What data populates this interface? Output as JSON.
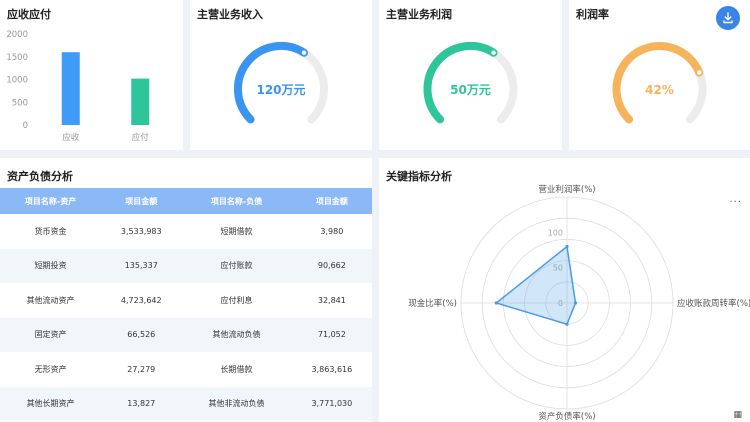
{
  "ar_card": {
    "title": "应收应付",
    "chart_data": {
      "type": "bar",
      "categories": [
        "应收",
        "应付"
      ],
      "values": [
        1600,
        1020
      ],
      "ylim": [
        0,
        2000
      ],
      "yticks": [
        0,
        500,
        1000,
        1500,
        2000
      ],
      "colors": [
        "#3e9bf6",
        "#2fc59b"
      ],
      "grid": false
    }
  },
  "revenue_card": {
    "title": "主营业务收入",
    "value_label": "120万元",
    "fraction": 0.62,
    "color": "#3a95f0"
  },
  "profit_card": {
    "title": "主营业务利润",
    "value_label": "50万元",
    "fraction": 0.62,
    "color": "#2fc59b"
  },
  "rate_card": {
    "title": "利润率",
    "value_label": "42%",
    "fraction": 0.75,
    "color": "#f5b45c"
  },
  "balance_card": {
    "title": "资产负债分析",
    "headers": [
      "项目名称-资产",
      "项目金额",
      "项目名称-负债",
      "项目金额"
    ],
    "rows": [
      [
        "货币资金",
        "3,533,983",
        "短期借款",
        "3,980"
      ],
      [
        "短期投资",
        "135,337",
        "应付账款",
        "90,662"
      ],
      [
        "其他流动资产",
        "4,723,642",
        "应付利息",
        "32,841"
      ],
      [
        "固定资产",
        "66,526",
        "其他流动负债",
        "71,052"
      ],
      [
        "无形资产",
        "27,279",
        "长期借款",
        "3,863,616"
      ],
      [
        "其他长期资产",
        "13,827",
        "其他非流动负债",
        "3,771,030"
      ]
    ]
  },
  "radar_card": {
    "title": "关键指标分析",
    "more_label": "...",
    "chart_data": {
      "type": "radar",
      "indicators": [
        "营业利润率(%)",
        "应收账款周转率(%)",
        "资产负债率(%)",
        "现金比率(%)"
      ],
      "values": [
        80,
        12,
        30,
        100
      ],
      "ticks": [
        0,
        50,
        100
      ],
      "max": 150,
      "color": "#4a9ae8"
    }
  },
  "colors": {
    "accent": "#3a84e8",
    "header_bg": "#8bb8f7",
    "row_alt": "#f1f6fb",
    "page_bg": "#eef1f5"
  }
}
